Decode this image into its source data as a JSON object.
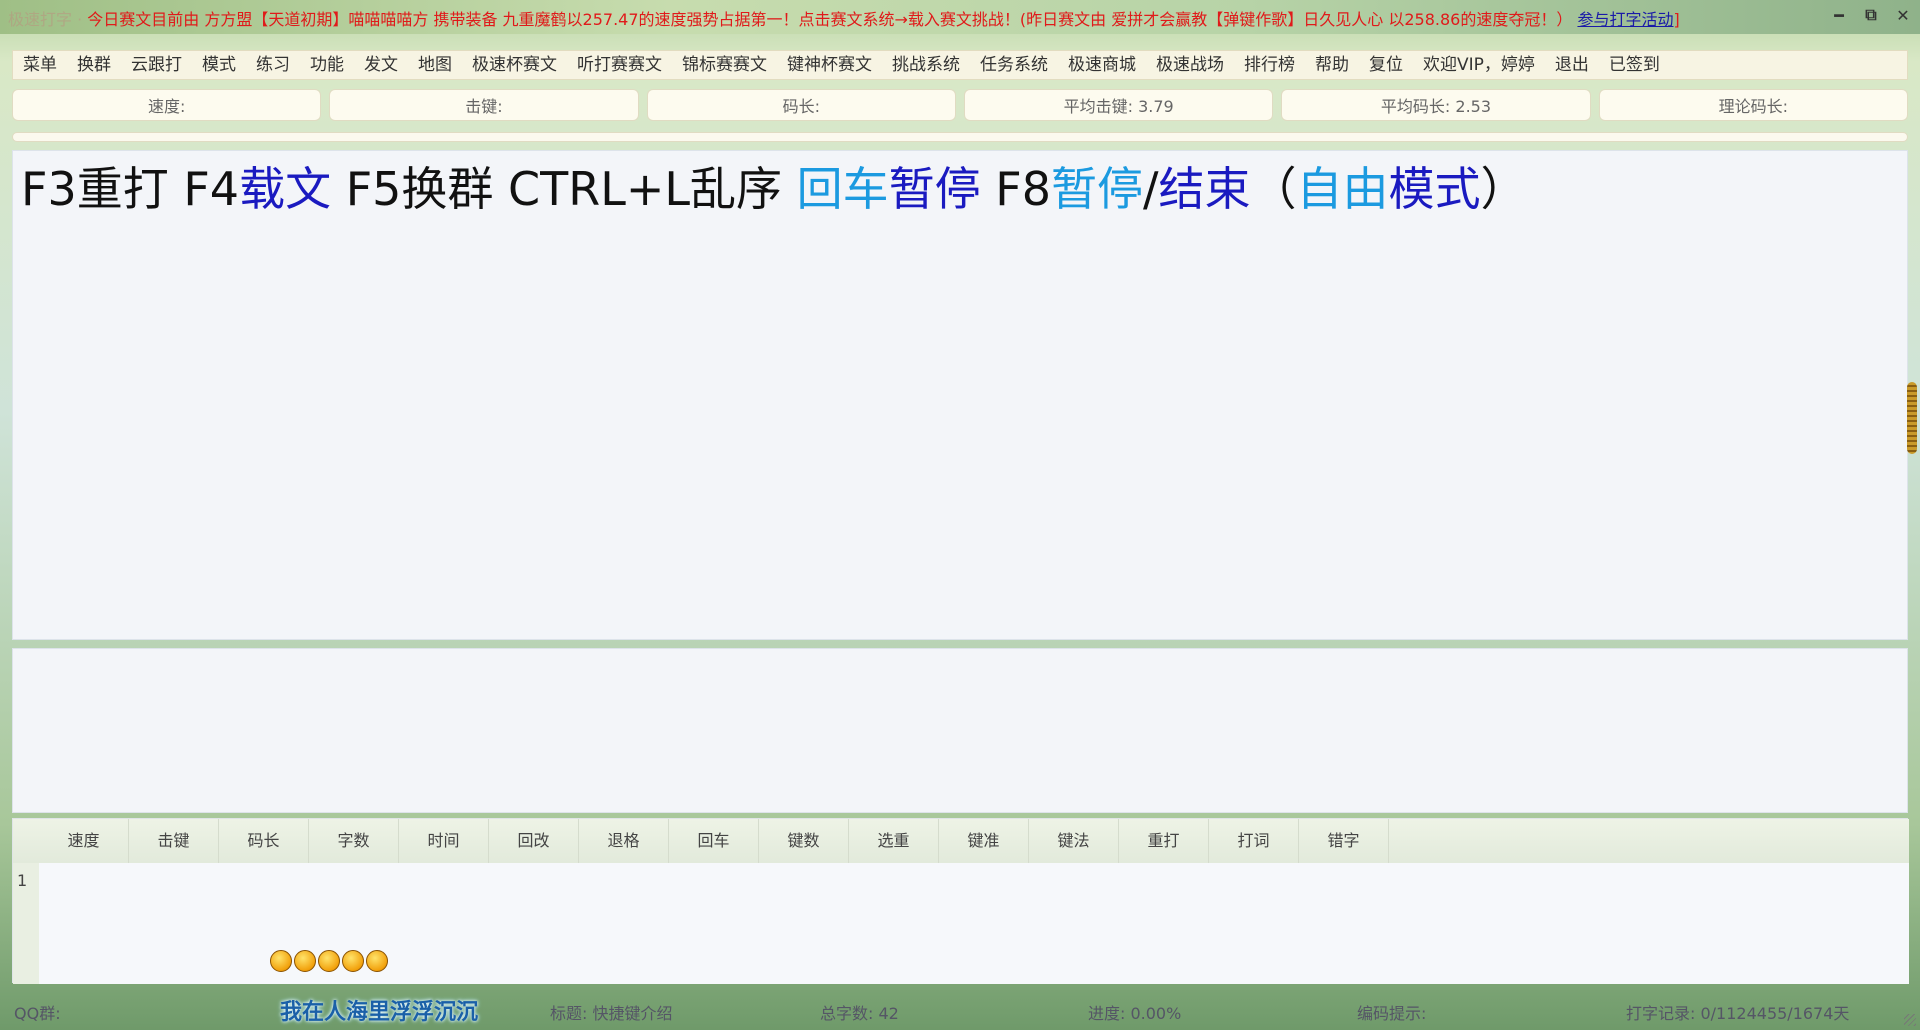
{
  "titlebar": {
    "faded_prefix": "极速打字 ·",
    "marquee": "今日赛文目前由 方方盟【天道初期】喵喵喵喵方 携带装备 九重魔鹤以257.47的速度强势占据第一！点击赛文系统→载入赛文挑战！(昨日赛文由 爱拼才会赢教【弹键作歌】日久见人心 以258.86的速度夺冠！）",
    "link": "参与打字活动",
    "bracket": "]"
  },
  "window_controls": {
    "minimize": "━",
    "restore": "⧉",
    "close": "✕"
  },
  "menu": [
    "菜单",
    "换群",
    "云跟打",
    "模式",
    "练习",
    "功能",
    "发文",
    "地图",
    "极速杯赛文",
    "听打赛赛文",
    "锦标赛赛文",
    "键神杯赛文",
    "挑战系统",
    "任务系统",
    "极速商城",
    "极速战场",
    "排行榜",
    "帮助",
    "复位",
    "欢迎VIP，婷婷",
    "退出",
    "已签到"
  ],
  "stats": {
    "speed": "速度:",
    "keystroke": "击键:",
    "code_length": "码长:",
    "avg_keystroke": "平均击键: 3.79",
    "avg_code_length": "平均码长: 2.53",
    "theory_code_length": "理论码长:"
  },
  "text": {
    "s1": "F3重打 F4",
    "s2": "载文",
    "s3": " F5换群 CTRL+L乱序 ",
    "s4": "回车",
    "s5": "暂停",
    "s6": " F8",
    "s7": "暂停",
    "s8": "/",
    "s9": "结束",
    "s10": "（",
    "s11": "自由",
    "s12": "模式",
    "s13": "）"
  },
  "results": {
    "columns": [
      "速度",
      "击键",
      "码长",
      "字数",
      "时间",
      "回改",
      "退格",
      "回车",
      "键数",
      "选重",
      "键准",
      "键法",
      "重打",
      "打词",
      "错字"
    ],
    "rows": [
      {
        "index": "1"
      }
    ]
  },
  "status": {
    "qq_group": "QQ群:",
    "motto": "我在人海里浮浮沉沉",
    "title": "标题: 快捷键介绍",
    "total_chars": "总字数: 42",
    "progress": "进度: 0.00%",
    "encoding_hint": "编码提示:",
    "typing_record": "打字记录: 0/1124455/1674天"
  },
  "colors": {
    "marquee": "#e01a1a",
    "accent_blue": "#1a1ac0",
    "accent_cyan": "#1b9ae0",
    "coin": "#f2a10c"
  }
}
